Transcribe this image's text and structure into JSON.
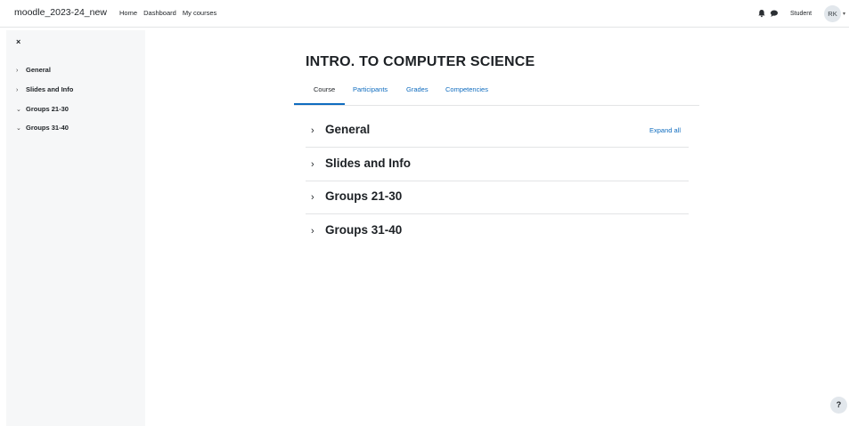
{
  "navbar": {
    "site_name": "moodle_2023-24_new",
    "links": [
      "Home",
      "Dashboard",
      "My courses"
    ],
    "user_name": "Student",
    "avatar_initials": "RK",
    "icons": [
      "bell-icon",
      "chat-icon",
      "chevron-down-icon"
    ]
  },
  "drawer": {
    "close_symbol": "×",
    "items": [
      {
        "label": "General",
        "chevron": "›"
      },
      {
        "label": "Slides and Info",
        "chevron": "›"
      },
      {
        "label": "Groups 21-30",
        "chevron": "⌄"
      },
      {
        "label": "Groups 31-40",
        "chevron": "⌄"
      }
    ]
  },
  "course": {
    "title": "INTRO. TO COMPUTER SCIENCE",
    "tabs": [
      "Course",
      "Participants",
      "Grades",
      "Competencies"
    ],
    "active_tab": "Course",
    "expand_all_label": "Expand all",
    "sections": [
      "General",
      "Slides and Info",
      "Groups 21-30",
      "Groups 31-40"
    ]
  },
  "help": {
    "label": "?"
  },
  "colors": {
    "link": "#0f6cbf",
    "drawer_bg": "#f6f7f8",
    "border": "#e3e4e6",
    "text": "#1d2125"
  }
}
